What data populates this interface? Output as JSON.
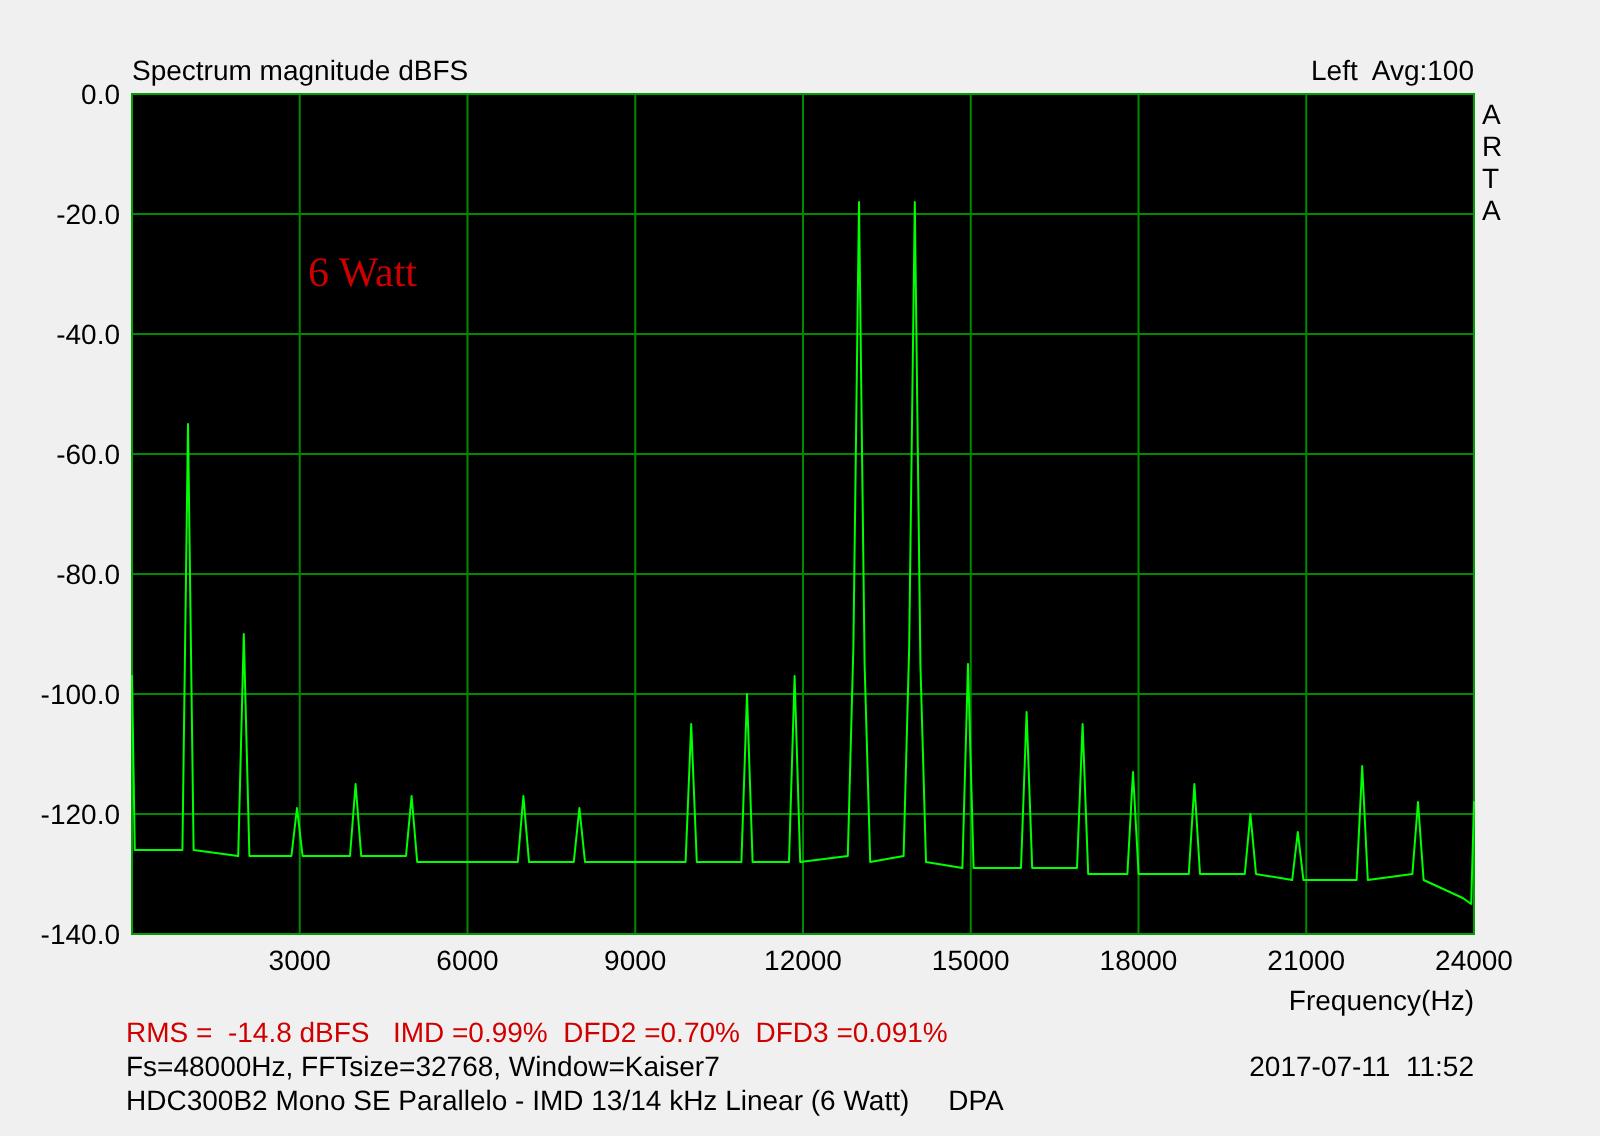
{
  "chart": {
    "channel_info": "Left  Avg:100",
    "brand": "ARTA",
    "chart_data": {
      "type": "line",
      "title": "Spectrum magnitude dBFS",
      "xlabel": "Frequency(Hz)",
      "xlim": [
        0,
        24000
      ],
      "ylim": [
        -140,
        0
      ],
      "xticks": [
        3000,
        6000,
        9000,
        12000,
        15000,
        18000,
        21000,
        24000
      ],
      "yticks": [
        {
          "value": 0,
          "label": "0.0"
        },
        {
          "value": -20,
          "label": "-20.0"
        },
        {
          "value": -40,
          "label": "-40.0"
        },
        {
          "value": -60,
          "label": "-60.0"
        },
        {
          "value": -80,
          "label": "-80.0"
        },
        {
          "value": -100,
          "label": "-100.0"
        },
        {
          "value": -120,
          "label": "-120.0"
        },
        {
          "value": -140,
          "label": "-140.0"
        }
      ],
      "x": [
        0,
        50,
        150,
        900,
        1000,
        1100,
        1900,
        2000,
        2100,
        2850,
        2950,
        3050,
        3900,
        4000,
        4100,
        4900,
        5000,
        5100,
        6900,
        7000,
        7100,
        7900,
        8000,
        8100,
        9900,
        10000,
        10100,
        10900,
        11000,
        11100,
        11750,
        11850,
        11950,
        12800,
        12900,
        13000,
        13100,
        13200,
        13800,
        13900,
        14000,
        14100,
        14200,
        14850,
        14950,
        15050,
        15900,
        16000,
        16100,
        16900,
        17000,
        17100,
        17800,
        17900,
        18000,
        18900,
        19000,
        19100,
        19900,
        20000,
        20100,
        20750,
        20850,
        20950,
        21900,
        22000,
        22100,
        22900,
        23000,
        23100,
        23800,
        23950,
        24000
      ],
      "grid": true,
      "series": [
        {
          "color": "#00ff00",
          "values": [
            -97,
            -126,
            -126,
            -126,
            -55,
            -126,
            -127,
            -90,
            -127,
            -127,
            -119,
            -127,
            -127,
            -115,
            -127,
            -127,
            -117,
            -128,
            -128,
            -117,
            -128,
            -128,
            -119,
            -128,
            -128,
            -105,
            -128,
            -128,
            -100,
            -128,
            -128,
            -97,
            -128,
            -127,
            -92,
            -18,
            -95,
            -128,
            -127,
            -92,
            -18,
            -95,
            -128,
            -129,
            -95,
            -129,
            -129,
            -103,
            -129,
            -129,
            -105,
            -130,
            -130,
            -113,
            -130,
            -130,
            -115,
            -130,
            -130,
            -120,
            -130,
            -131,
            -123,
            -131,
            -131,
            -112,
            -131,
            -130,
            -118,
            -131,
            -134,
            -135,
            -118
          ]
        }
      ],
      "annotations": [
        "6 Watt"
      ]
    }
  },
  "footer": {
    "readout": "RMS =  -14.8 dBFS   IMD =0.99%  DFD2 =0.70%  DFD3 =0.091%",
    "settings": "Fs=48000Hz, FFTsize=32768, Window=Kaiser7",
    "timestamp": "2017-07-11  11:52",
    "description": "HDC300B2 Mono SE Parallelo - IMD 13/14 kHz Linear (6 Watt)     DPA"
  }
}
